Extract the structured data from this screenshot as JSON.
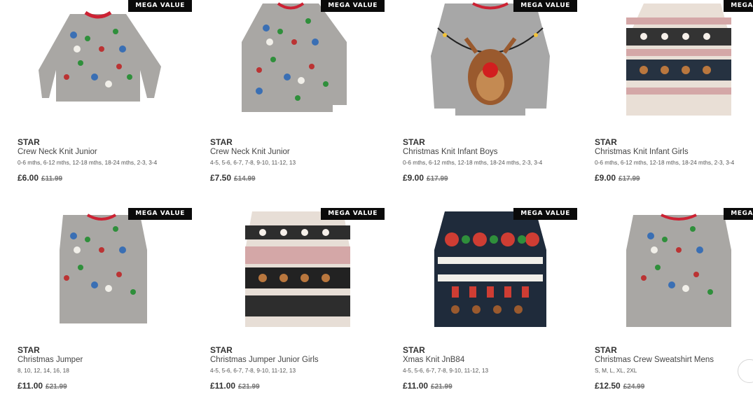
{
  "badge_label": "MEGA VALUE",
  "products": [
    {
      "brand": "STAR",
      "title": "Crew Neck Knit Junior",
      "sizes": "0-6 mths, 6-12 mths, 12-18 mths, 18-24 mths, 2-3, 3-4",
      "price": "£6.00",
      "was": "£11.99",
      "style": "grey-pattern"
    },
    {
      "brand": "STAR",
      "title": "Crew Neck Knit Junior",
      "sizes": "4-5, 5-6, 6-7, 7-8, 9-10, 11-12, 13",
      "price": "£7.50",
      "was": "£14.99",
      "style": "grey-pattern"
    },
    {
      "brand": "STAR",
      "title": "Christmas Knit Infant Boys",
      "sizes": "0-6 mths, 6-12 mths, 12-18 mths, 18-24 mths, 2-3, 3-4",
      "price": "£9.00",
      "was": "£17.99",
      "style": "reindeer"
    },
    {
      "brand": "STAR",
      "title": "Christmas Knit Infant Girls",
      "sizes": "0-6 mths, 6-12 mths, 12-18 mths, 18-24 mths, 2-3, 3-4",
      "price": "£9.00",
      "was": "£17.99",
      "style": "fairisle-light"
    },
    {
      "brand": "STAR",
      "title": "Christmas Jumper",
      "sizes": "8, 10, 12, 14, 16, 18",
      "price": "£11.00",
      "was": "£21.99",
      "style": "grey-pattern"
    },
    {
      "brand": "STAR",
      "title": "Christmas Jumper Junior Girls",
      "sizes": "4-5, 5-6, 6-7, 7-8, 9-10, 11-12, 13",
      "price": "£11.00",
      "was": "£21.99",
      "style": "fairisle-dark"
    },
    {
      "brand": "STAR",
      "title": "Xmas Knit JnB84",
      "sizes": "4-5, 5-6, 6-7, 7-8, 9-10, 11-12, 13",
      "price": "£11.00",
      "was": "£21.99",
      "style": "navy-falala"
    },
    {
      "brand": "STAR",
      "title": "Christmas Crew Sweatshirt Mens",
      "sizes": "S, M, L, XL, 2XL",
      "price": "£12.50",
      "was": "£24.99",
      "style": "grey-pattern"
    }
  ]
}
